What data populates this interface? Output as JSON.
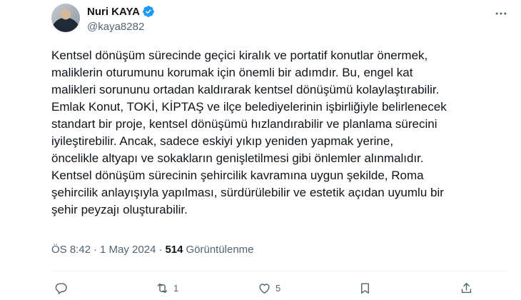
{
  "author": {
    "display_name": "Nuri KAYA",
    "handle": "@kaya8282"
  },
  "tweet": {
    "lines": [
      "Kentsel dönüşüm sürecinde geçici kiralık ve portatif konutlar önermek,",
      "maliklerin oturumunu korumak için önemli bir adımdır. Bu, engel kat",
      "malikleri sorununu ortadan kaldırarak kentsel dönüşümü kolaylaştırabilir.",
      "Emlak Konut, TOKİ, KİPTAŞ ve ilçe belediyelerinin işbirliğiyle belirlenecek",
      "standart bir proje, kentsel dönüşümü hızlandırabilir ve planlama sürecini",
      "iyileştirebilir. Ancak, sadece eskiyi yıkıp yeniden yapmak yerine,",
      "öncelikle altyapı ve sokakların genişletilmesi gibi önlemler alınmalıdır.",
      "Kentsel dönüşüm sürecinin şehircilik kavramına uygun şekilde, Roma",
      "şehircilik anlayışıyla yapılması, sürdürülebilir ve estetik açıdan uyumlu bir",
      "şehir peyzajı oluşturabilir."
    ]
  },
  "meta": {
    "time": "ÖS 8:42",
    "separator": "·",
    "date": "1 May 2024",
    "views_count": "514",
    "views_label": "Görüntülenme"
  },
  "actions": {
    "replies": "",
    "retweets": "1",
    "likes": "5"
  },
  "icons": [
    "verified-badge-icon",
    "more-icon",
    "reply-icon",
    "retweet-icon",
    "like-icon",
    "bookmark-icon",
    "share-icon"
  ],
  "colors": {
    "text": "#0f1419",
    "secondary": "#536471",
    "verified": "#1d9bf0",
    "divider": "#eff3f4"
  }
}
